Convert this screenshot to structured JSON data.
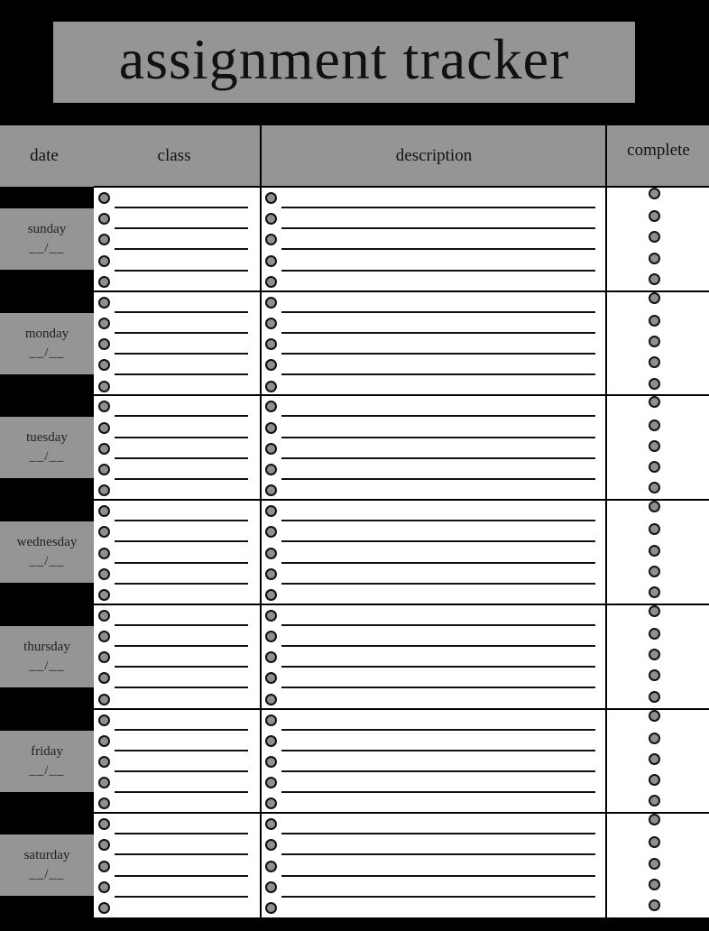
{
  "title": "assignment tracker",
  "columns": {
    "date": "date",
    "class": "class",
    "description": "description",
    "complete": "complete"
  },
  "days": [
    {
      "name": "sunday",
      "date": "__/__"
    },
    {
      "name": "monday",
      "date": "__/__"
    },
    {
      "name": "tuesday",
      "date": "__/__"
    },
    {
      "name": "wednesday",
      "date": "__/__"
    },
    {
      "name": "thursday",
      "date": "__/__"
    },
    {
      "name": "friday",
      "date": "__/__"
    },
    {
      "name": "saturday",
      "date": "__/__"
    }
  ],
  "entries_per_day": 5,
  "colors": {
    "background": "#000000",
    "panel": "#959595",
    "paper": "#ffffff",
    "bullet": "#8f8f8f"
  }
}
